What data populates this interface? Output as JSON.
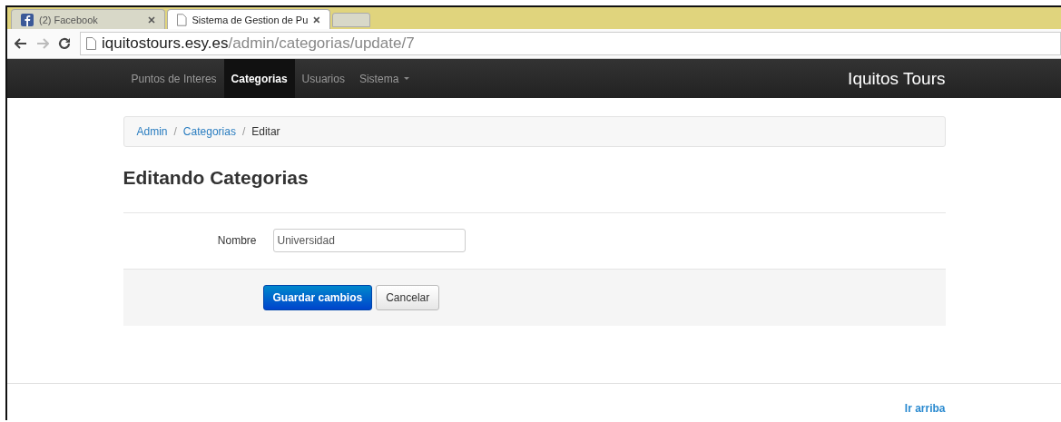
{
  "browser": {
    "tabs": [
      {
        "title": "(2) Facebook",
        "kind": "facebook",
        "selected": false
      },
      {
        "title": "Sistema de Gestion de Pu",
        "kind": "page",
        "selected": true
      }
    ],
    "url": {
      "host": "iquitostours.esy.es",
      "path": "/admin/categorias/update/7"
    }
  },
  "navbar": {
    "items": [
      {
        "label": "Puntos de Interes",
        "selected": false,
        "dropdown": false
      },
      {
        "label": "Categorias",
        "selected": true,
        "dropdown": false
      },
      {
        "label": "Usuarios",
        "selected": false,
        "dropdown": false
      },
      {
        "label": "Sistema",
        "selected": false,
        "dropdown": true
      }
    ],
    "brand": "Iquitos Tours"
  },
  "breadcrumb": [
    {
      "label": "Admin",
      "kind": "link"
    },
    {
      "label": "Categorias",
      "kind": "link"
    },
    {
      "label": "Editar",
      "kind": "current"
    }
  ],
  "breadcrumb_separators": [
    "/",
    "/"
  ],
  "heading": "Editando Categorias",
  "form": {
    "label": "Nombre",
    "value": "Universidad"
  },
  "buttons": [
    {
      "label": "Guardar cambios",
      "kind": "primary"
    },
    {
      "label": "Cancelar",
      "kind": "default"
    }
  ],
  "footer": {
    "link": "Ir arriba"
  }
}
